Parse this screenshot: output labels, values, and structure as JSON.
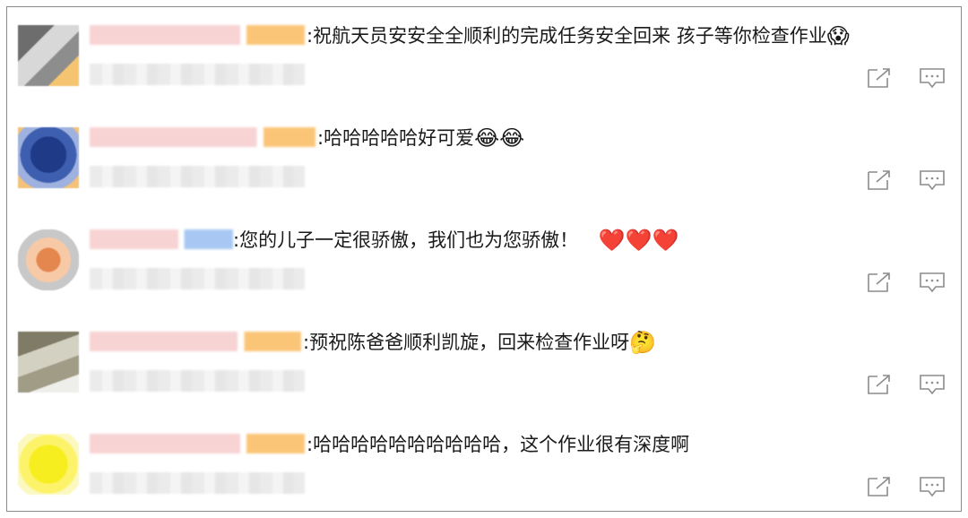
{
  "comments": [
    {
      "text": ":祝航天员安安全全顺利的完成任务安全回来 孩子等你检查作业",
      "emojis": [
        "😱"
      ],
      "avatar_colors": [
        "#5a5a5a",
        "#a8a8a8",
        "#e8e8e8",
        "#f5b85a"
      ],
      "name_colors": [
        "#f6c6c6",
        "#fbd88a"
      ]
    },
    {
      "text": ":哈哈哈哈哈好可爱",
      "emojis": [
        "😂",
        "😂"
      ],
      "avatar_colors": [
        "#23408c",
        "#4a67b5",
        "#8aa0d8",
        "#f5b85a"
      ],
      "name_colors": [
        "#f6c6c6",
        "#fbd88a"
      ]
    },
    {
      "text": ":您的儿子一定很骄傲，我们也为您骄傲！",
      "emojis": [
        "❤️",
        "❤️",
        "❤️"
      ],
      "avatar_colors": [
        "#e8905a",
        "#f7c8a8",
        "#bfbfbf",
        "#f5b85a"
      ],
      "name_colors": [
        "#f6c6c6",
        "#a9c8f2"
      ]
    },
    {
      "text": ":预祝陈爸爸顺利凯旋，回来检查作业呀",
      "emojis": [
        "🤔"
      ],
      "avatar_colors": [
        "#8a8670",
        "#c9c7b5",
        "#e9e8de",
        "#b5b0a0"
      ],
      "name_colors": [
        "#f6c6c6",
        "#fbd88a"
      ]
    },
    {
      "text": ":哈哈哈哈哈哈哈哈哈哈，这个作业很有深度啊",
      "emojis": [],
      "avatar_colors": [
        "#f7ef2a",
        "#fff45c",
        "#fbf8b0",
        "#f7ef2a"
      ],
      "name_colors": [
        "#f6c6c6",
        "#fbd88a"
      ]
    }
  ],
  "icons": {
    "share": "share-icon",
    "reply": "comment-icon"
  }
}
